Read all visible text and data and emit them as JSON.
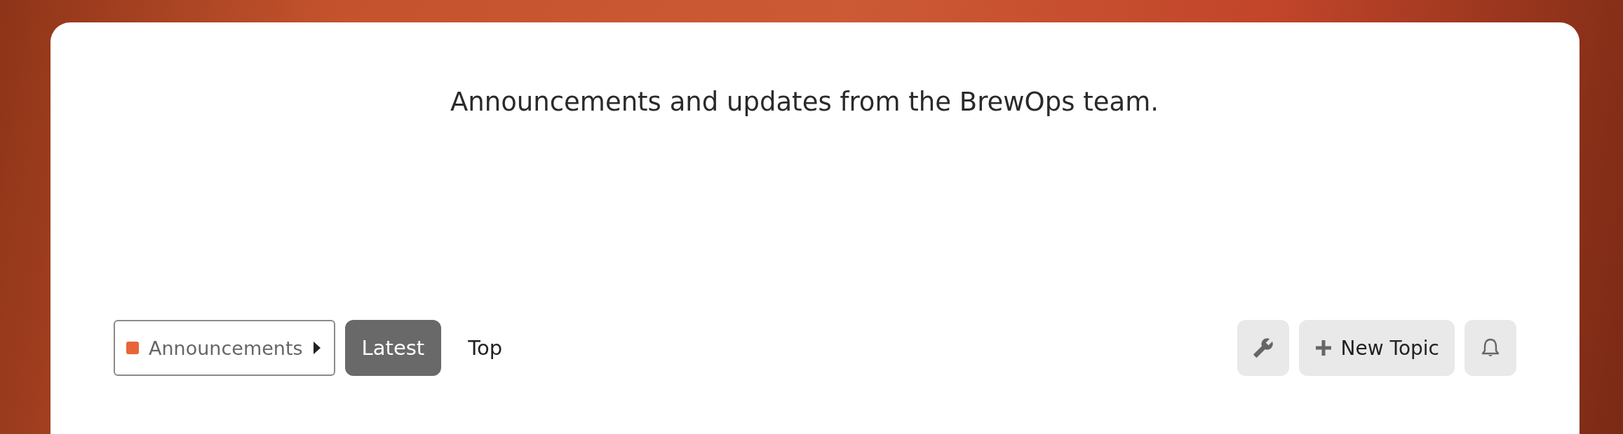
{
  "description": "Announcements and updates from the BrewOps team.",
  "category": {
    "name": "Announcements",
    "color": "#e8653a"
  },
  "tabs": [
    {
      "label": "Latest",
      "selected": true
    },
    {
      "label": "Top",
      "selected": false
    }
  ],
  "new_topic_button": {
    "label": "New Topic"
  }
}
